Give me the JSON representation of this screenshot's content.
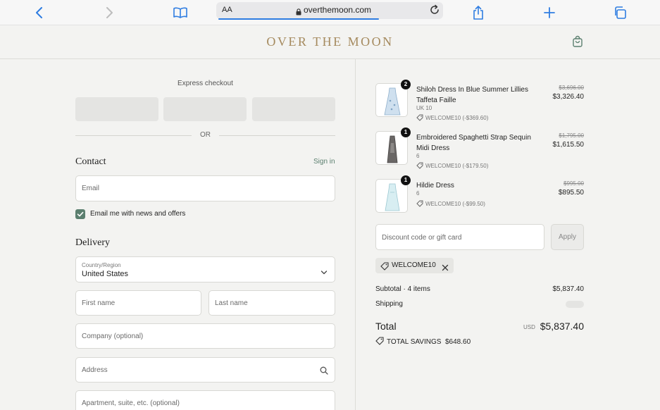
{
  "browser": {
    "text_size_label": "AA",
    "url": "overthemoon.com"
  },
  "site": {
    "brand": "OVER THE MOON"
  },
  "checkout": {
    "express_label": "Express checkout",
    "or_label": "OR",
    "contact_title": "Contact",
    "sign_in_label": "Sign in",
    "email_placeholder": "Email",
    "newsletter_label": "Email me with news and offers",
    "newsletter_checked": true,
    "delivery_title": "Delivery",
    "country_label": "Country/Region",
    "country_value": "United States",
    "first_name_placeholder": "First name",
    "last_name_placeholder": "Last name",
    "company_placeholder": "Company (optional)",
    "address_placeholder": "Address",
    "apartment_placeholder": "Apartment, suite, etc. (optional)"
  },
  "order": {
    "items": [
      {
        "qty": "2",
        "name": "Shiloh Dress In Blue Summer Lillies Taffeta Faille",
        "variant": "UK 10",
        "discount": "WELCOME10 (-$369.60)",
        "price_old": "$3,696.00",
        "price_new": "$3,326.40"
      },
      {
        "qty": "1",
        "name": "Embroidered Spaghetti Strap Sequin Midi Dress",
        "variant": "6",
        "discount": "WELCOME10 (-$179.50)",
        "price_old": "$1,795.00",
        "price_new": "$1,615.50"
      },
      {
        "qty": "1",
        "name": "Hildie Dress",
        "variant": "6",
        "discount": "WELCOME10 (-$99.50)",
        "price_old": "$995.00",
        "price_new": "$895.50"
      }
    ],
    "discount_placeholder": "Discount code or gift card",
    "apply_label": "Apply",
    "applied_code": "WELCOME10",
    "subtotal_label": "Subtotal · 4 items",
    "subtotal_value": "$5,837.40",
    "shipping_label": "Shipping",
    "total_label": "Total",
    "total_currency": "USD",
    "total_value": "$5,837.40",
    "savings_label": "TOTAL SAVINGS",
    "savings_value": "$648.60"
  },
  "colors": {
    "accent_green": "#5b7f6f",
    "brand_gold": "#a58a5e",
    "browser_blue": "#2f7de1"
  }
}
